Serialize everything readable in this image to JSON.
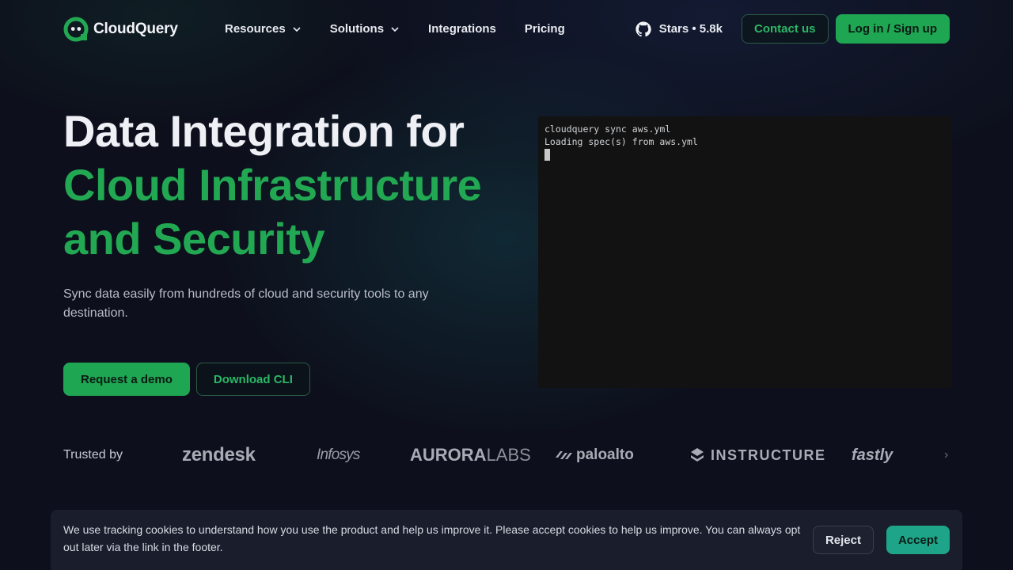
{
  "nav": {
    "brand": "CloudQuery",
    "links": [
      {
        "label": "Resources",
        "has_dropdown": true
      },
      {
        "label": "Solutions",
        "has_dropdown": true
      },
      {
        "label": "Integrations",
        "has_dropdown": false
      },
      {
        "label": "Pricing",
        "has_dropdown": false
      }
    ],
    "stars_label": "Stars • 5.8k",
    "contact_label": "Contact us",
    "login_label": "Log in / Sign up"
  },
  "hero": {
    "title_line1": "Data Integration for",
    "title_line2": "Cloud Infrastructure",
    "title_line3": "and Security",
    "subtitle": "Sync data easily from hundreds of cloud and security tools to any destination.",
    "primary_cta": "Request a demo",
    "secondary_cta": "Download CLI"
  },
  "terminal": {
    "lines": [
      "cloudquery sync aws.yml",
      "Loading spec(s) from aws.yml"
    ]
  },
  "trusted": {
    "label": "Trusted by",
    "logos": {
      "zendesk": "zendesk",
      "infosys": "Infosys",
      "aurora_bold": "AURORA",
      "aurora_light": "LABS",
      "paloalto": "paloalto",
      "instructure": "INSTRUCTURE",
      "fastly": "fastly"
    }
  },
  "cookie": {
    "text": "We use tracking cookies to understand how you use the product and help us improve it. Please accept cookies to help us improve. You can always opt out later via the link in the footer.",
    "reject_label": "Reject",
    "accept_label": "Accept"
  },
  "colors": {
    "background": "#0d101c",
    "accent_green": "#1ea653",
    "accept_teal": "#1ea589"
  },
  "icons": [
    "cloudquery-logo-icon",
    "chevron-down-icon",
    "github-icon",
    "paloalto-icon",
    "instructure-icon",
    "chevron-right-icon"
  ]
}
